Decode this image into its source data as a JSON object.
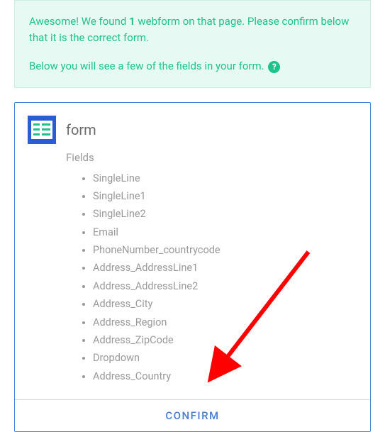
{
  "alert": {
    "line1_prefix": "Awesome! We found ",
    "line1_count": "1",
    "line1_suffix": " webform on that page. Please confirm below that it is the correct form.",
    "line2": "Below you will see a few of the fields in your form. "
  },
  "form": {
    "title": "form",
    "fields_label": "Fields",
    "fields": [
      "SingleLine",
      "SingleLine1",
      "SingleLine2",
      "Email",
      "PhoneNumber_countrycode",
      "Address_AddressLine1",
      "Address_AddressLine2",
      "Address_City",
      "Address_Region",
      "Address_ZipCode",
      "Dropdown",
      "Address_Country"
    ]
  },
  "confirm_label": "CONFIRM",
  "icons": {
    "help_glyph": "?"
  }
}
